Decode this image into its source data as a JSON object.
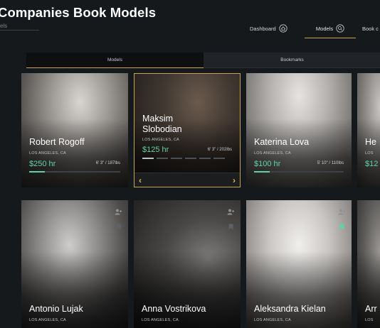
{
  "app": {
    "title": "Companies Book Models",
    "subtitle": "els"
  },
  "nav": [
    {
      "label": "Dashboard",
      "icon": "house-icon"
    },
    {
      "label": "Models",
      "icon": "search-icon"
    },
    {
      "label": "Book c",
      "icon": ""
    }
  ],
  "tabs": [
    "Models",
    "Bookmarks"
  ],
  "cards_row1": [
    {
      "name": "Robert Rogoff",
      "location": "LOS ANGELES, CA",
      "rate": "$250 hr",
      "dims": "6' 3\" / 187lbs"
    },
    {
      "name_line1": "Maksim",
      "name_line2": "Slobodian",
      "location": "LOS ANGELES, CA",
      "rate": "$125 hr",
      "dims": "6' 3\" / 202lbs"
    },
    {
      "name": "Katerina Lova",
      "location": "LOS ANGELES, CA",
      "rate": "$100 hr",
      "dims": "5' 10\" / 110lbs"
    },
    {
      "name": "He",
      "location": "LOS",
      "rate": "$12"
    }
  ],
  "cards_row2": [
    {
      "name": "Antonio Lujak",
      "location": "LOS ANGELES, CA"
    },
    {
      "name": "Anna Vostrikova",
      "location": "LOS ANGELES, CA"
    },
    {
      "name": "Aleksandra Kielan",
      "location": "LOS ANGELES, CA"
    },
    {
      "name": "Arr",
      "location": "LOS"
    }
  ],
  "colors": {
    "accent": "#c9a24c",
    "rate": "#5fd3a6",
    "background": "#16191b"
  }
}
